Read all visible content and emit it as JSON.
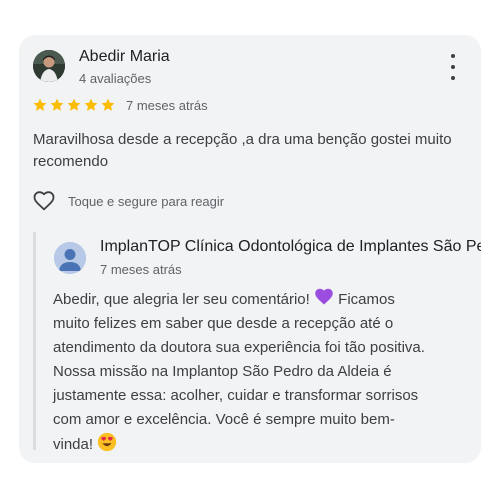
{
  "review": {
    "author_name": "Abedir Maria",
    "author_meta": "4 avaliações",
    "rating": 5,
    "max_rating": 5,
    "time": "7 meses atrás",
    "text": "Maravilhosa desde a recepção ,a dra uma benção gostei muito recomendo",
    "react_label": "Toque e segure para reagir"
  },
  "reply": {
    "owner_name": "ImplanTOP Clínica Odontológica de Implantes São Pedro da Aldeia",
    "time": "7 meses atrás",
    "lines": {
      "l1a": "Abedir, que alegria ler seu comentário!",
      "l1b": "Ficamos",
      "l2": "muito felizes em saber que desde a recepção até o",
      "l3": "atendimento da doutora sua experiência foi tão positiva.",
      "l4": "Nossa missão na Implantop São Pedro da Aldeia é",
      "l5": "justamente essa: acolher, cuidar e transformar sorrisos",
      "l6": "com amor e excelência. Você é sempre muito bem-",
      "l7": "vinda!"
    },
    "emojis": [
      "purple-heart-icon",
      "heart-eyes-icon"
    ]
  },
  "colors": {
    "card_bg": "#f1f3f4",
    "star": "#fbbc04",
    "purple_heart": "#9b4de0",
    "emoji_face": "#fbbf24",
    "emoji_heart": "#e3284a"
  }
}
